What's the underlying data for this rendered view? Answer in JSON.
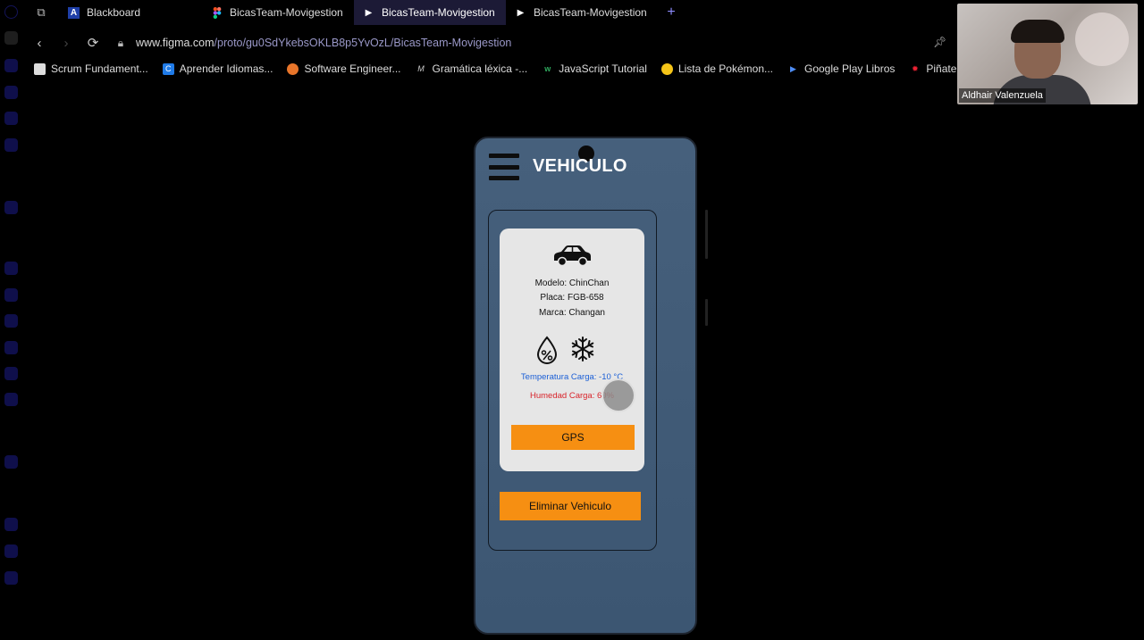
{
  "browser": {
    "tabs": [
      {
        "label": "Blackboard",
        "fav": "A"
      },
      {
        "label": "BicasTeam-Movigestion",
        "fav": "figma"
      },
      {
        "label": "BicasTeam-Movigestion",
        "fav": "play"
      },
      {
        "label": "BicasTeam-Movigestion",
        "fav": "play"
      }
    ],
    "new_tab": "+",
    "url_domain": "www.figma.com",
    "url_path": "/proto/gu0SdYkebsOKLB8p5YvOzL/BicasTeam-Movigestion",
    "bookmarks": [
      "Scrum Fundament...",
      "Aprender Idiomas...",
      "Software Engineer...",
      "Gramática léxica -...",
      "JavaScript Tutorial",
      "Lista de Pokémon...",
      "Google Play Libros",
      "Piñatería arc"
    ]
  },
  "webcam": {
    "name": "Aldhair Valenzuela"
  },
  "app": {
    "title": "VEHICULO",
    "modelo": "Modelo: ChinChan",
    "placa": "Placa: FGB-658",
    "marca": "Marca: Changan",
    "temperatura": "Temperatura Carga: -10 °C",
    "humedad": "Humedad Carga: 60%",
    "gps_label": "GPS",
    "delete_label": "Eliminar Vehiculo"
  },
  "colors": {
    "accent_orange": "#f68f12",
    "temperature_blue": "#1b5fd6",
    "humidity_red": "#d8232a",
    "phone_bg": "#46607c"
  }
}
